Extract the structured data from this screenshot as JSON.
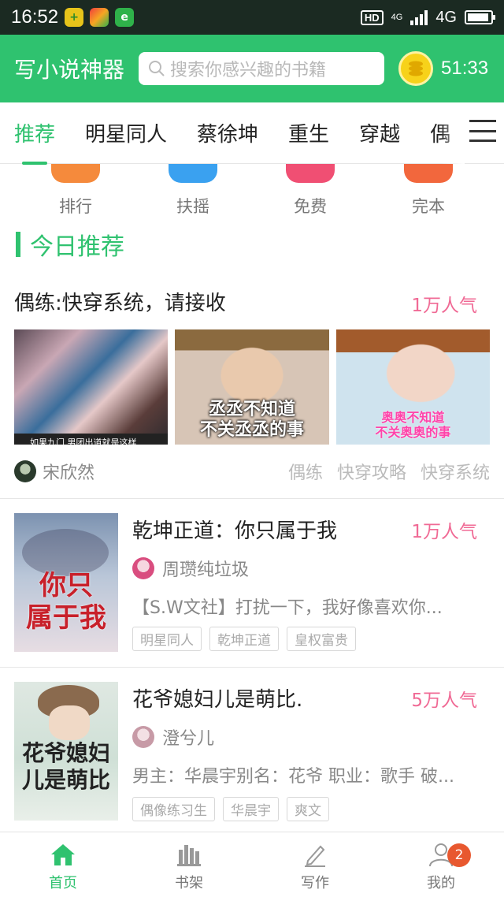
{
  "status_bar": {
    "time": "16:52",
    "hd": "HD",
    "net_small": "4G",
    "network": "4G"
  },
  "header": {
    "app_title": "写小说神器",
    "search_placeholder": "搜索你感兴趣的书籍",
    "timer": "51:33"
  },
  "tabs": [
    "推荐",
    "明星同人",
    "蔡徐坤",
    "重生",
    "穿越",
    "偶"
  ],
  "quick_links": [
    {
      "label": "排行",
      "color": "#f58a3c"
    },
    {
      "label": "扶摇",
      "color": "#3aa1f0"
    },
    {
      "label": "免费",
      "color": "#f04f73"
    },
    {
      "label": "完本",
      "color": "#f2673d"
    }
  ],
  "section_title": "今日推荐",
  "featured": {
    "title": "偶练:快穿系统，请接收",
    "popularity": "1万人气",
    "image_captions": [
      "",
      "丞丞不知道\n不关丞丞的事",
      "奥奥不知道\n不关奥奥的事"
    ],
    "image1_strip": "如果九门 男团出道就是这样",
    "author": "宋欣然",
    "tags": [
      "偶练",
      "快穿攻略",
      "快穿系统"
    ]
  },
  "books": [
    {
      "title": "乾坤正道：你只属于我",
      "popularity": "1万人气",
      "author": "周瓒纯垃圾",
      "description": "【S.W文社】打扰一下，我好像喜欢你...",
      "tags": [
        "明星同人",
        "乾坤正道",
        "皇权富贵"
      ],
      "cover_text": "你只\n属于我"
    },
    {
      "title": "花爷媳妇儿是萌比.",
      "popularity": "5万人气",
      "author": "澄兮儿",
      "description": "男主：华晨宇别名：花爷 职业：歌手 破...",
      "tags": [
        "偶像练习生",
        "华晨宇",
        "爽文"
      ],
      "cover_text": "花爷媳妇\n儿是萌比"
    }
  ],
  "bottom_nav": [
    {
      "label": "首页",
      "icon": "home-icon"
    },
    {
      "label": "书架",
      "icon": "bookshelf-icon"
    },
    {
      "label": "写作",
      "icon": "pen-icon"
    },
    {
      "label": "我的",
      "icon": "user-icon",
      "badge": "2"
    }
  ],
  "colors": {
    "brand_green": "#2fc26f",
    "popularity_pink": "#f06a95",
    "badge_orange": "#e8582f"
  }
}
